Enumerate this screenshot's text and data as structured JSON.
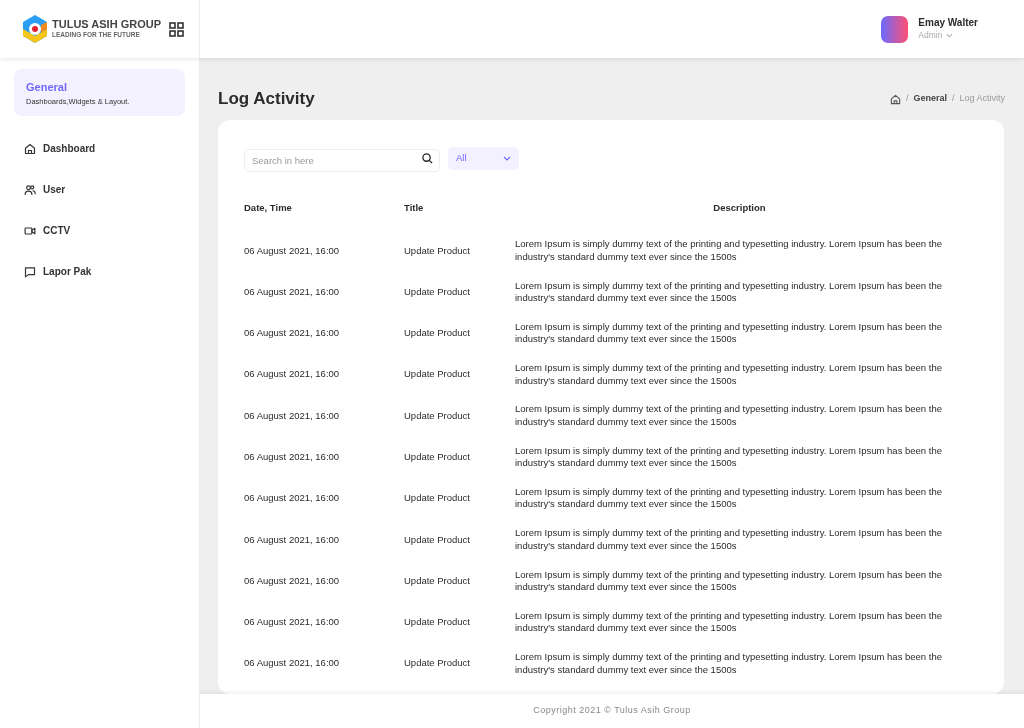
{
  "brand": {
    "name": "TULUS ASIH GROUP",
    "tagline": "LEADING FOR THE FUTURE"
  },
  "user": {
    "name": "Emay Walter",
    "role": "Admin"
  },
  "sidebar": {
    "section": {
      "title": "General",
      "subtitle": "Dashboards,Widgets & Layout.",
      "selected": true
    },
    "items": [
      {
        "label": "Dashboard",
        "selected": false
      },
      {
        "label": "User",
        "selected": false
      },
      {
        "label": "CCTV",
        "selected": false
      },
      {
        "label": "Lapor Pak",
        "selected": false
      }
    ]
  },
  "page": {
    "title": "Log Activity",
    "breadcrumb": [
      {
        "kind": "separator",
        "text": "/"
      },
      {
        "kind": "link",
        "text": "General"
      },
      {
        "kind": "separator",
        "text": "/"
      },
      {
        "kind": "current",
        "text": "Log Activity"
      }
    ]
  },
  "search": {
    "placeholder": "Search in here"
  },
  "filter": {
    "value": "All"
  },
  "table": {
    "columns": [
      "Date, Time",
      "Title",
      "Description"
    ],
    "rows": [
      [
        "06 August 2021, 16:00",
        "Update Product",
        "Lorem Ipsum is simply dummy text of the printing and typesetting industry. Lorem Ipsum has been the industry's standard dummy text ever since the 1500s"
      ],
      [
        "06 August 2021, 16:00",
        "Update Product",
        "Lorem Ipsum is simply dummy text of the printing and typesetting industry. Lorem Ipsum has been the industry's standard dummy text ever since the 1500s"
      ],
      [
        "06 August 2021, 16:00",
        "Update Product",
        "Lorem Ipsum is simply dummy text of the printing and typesetting industry. Lorem Ipsum has been the industry's standard dummy text ever since the 1500s"
      ],
      [
        "06 August 2021, 16:00",
        "Update Product",
        "Lorem Ipsum is simply dummy text of the printing and typesetting industry. Lorem Ipsum has been the industry's standard dummy text ever since the 1500s"
      ],
      [
        "06 August 2021, 16:00",
        "Update Product",
        "Lorem Ipsum is simply dummy text of the printing and typesetting industry. Lorem Ipsum has been the industry's standard dummy text ever since the 1500s"
      ],
      [
        "06 August 2021, 16:00",
        "Update Product",
        "Lorem Ipsum is simply dummy text of the printing and typesetting industry. Lorem Ipsum has been the industry's standard dummy text ever since the 1500s"
      ],
      [
        "06 August 2021, 16:00",
        "Update Product",
        "Lorem Ipsum is simply dummy text of the printing and typesetting industry. Lorem Ipsum has been the industry's standard dummy text ever since the 1500s"
      ],
      [
        "06 August 2021, 16:00",
        "Update Product",
        "Lorem Ipsum is simply dummy text of the printing and typesetting industry. Lorem Ipsum has been the industry's standard dummy text ever since the 1500s"
      ],
      [
        "06 August 2021, 16:00",
        "Update Product",
        "Lorem Ipsum is simply dummy text of the printing and typesetting industry. Lorem Ipsum has been the industry's standard dummy text ever since the 1500s"
      ],
      [
        "06 August 2021, 16:00",
        "Update Product",
        "Lorem Ipsum is simply dummy text of the printing and typesetting industry. Lorem Ipsum has been the industry's standard dummy text ever since the 1500s"
      ],
      [
        "06 August 2021, 16:00",
        "Update Product",
        "Lorem Ipsum is simply dummy text of the printing and typesetting industry. Lorem Ipsum has been the industry's standard dummy text ever since the 1500s"
      ]
    ]
  },
  "footer": {
    "text": "Copyright 2021 © Tulus Asih Group"
  }
}
